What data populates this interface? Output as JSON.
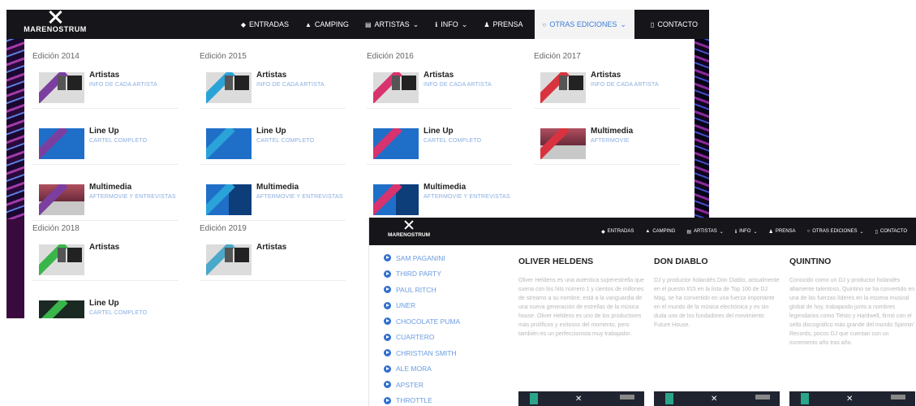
{
  "brand": "MARENOSTRUM",
  "nav": [
    {
      "label": "ENTRADAS",
      "icon": "ticket-icon"
    },
    {
      "label": "CAMPING",
      "icon": "tent-icon"
    },
    {
      "label": "ARTISTAS",
      "icon": "list-icon",
      "dropdown": true
    },
    {
      "label": "INFO",
      "icon": "info-icon",
      "dropdown": true
    },
    {
      "label": "PRENSA",
      "icon": "user-icon"
    },
    {
      "label": "OTRAS EDICIONES",
      "icon": "circle-icon",
      "dropdown": true,
      "active": true
    },
    {
      "label": "CONTACTO",
      "icon": "phone-icon"
    }
  ],
  "editions": [
    {
      "label": "Edición 2014",
      "color": "#7b3fa0",
      "items": [
        {
          "title": "Artistas",
          "sub": "INFO DE CADA ARTISTA"
        },
        {
          "title": "Line Up",
          "sub": "CARTEL COMPLETO"
        },
        {
          "title": "Multimedia",
          "sub": "AFTERMOVIE Y ENTREVISTAS"
        }
      ]
    },
    {
      "label": "Edición 2015",
      "color": "#2aa3d8",
      "items": [
        {
          "title": "Artistas",
          "sub": "INFO DE CADA ARTISTA"
        },
        {
          "title": "Line Up",
          "sub": "CARTEL COMPLETO"
        },
        {
          "title": "Multimedia",
          "sub": "AFTERMOVIE Y ENTREVISTAS"
        }
      ]
    },
    {
      "label": "Edición 2016",
      "color": "#d8336e",
      "items": [
        {
          "title": "Artistas",
          "sub": "INFO DE CADA ARTISTA"
        },
        {
          "title": "Line Up",
          "sub": "CARTEL COMPLETO"
        },
        {
          "title": "Multimedia",
          "sub": "AFTERMOVIE Y ENTREVISTAS"
        }
      ]
    },
    {
      "label": "Edición 2017",
      "color": "#d8333f",
      "items": [
        {
          "title": "Artistas",
          "sub": "INFO DE CADA ARTISTA"
        },
        {
          "title": "Multimedia",
          "sub": "AFTERMOVIE"
        }
      ]
    },
    {
      "label": "Edición 2018",
      "color": "#3ab54a",
      "items": [
        {
          "title": "Artistas",
          "sub": ""
        },
        {
          "title": "Line Up",
          "sub": "CARTEL COMPLETO"
        }
      ]
    },
    {
      "label": "Edición 2019",
      "color": "#4aa8c8",
      "items": [
        {
          "title": "Artistas",
          "sub": ""
        }
      ]
    }
  ],
  "artists_list": [
    "SAM PAGANINI",
    "THIRD PARTY",
    "PAUL RITCH",
    "UNER",
    "CHOCOLATE PUMA",
    "CUARTERO",
    "CHRISTIAN SMITH",
    "ALE MORA",
    "APSTER",
    "THROTTLE"
  ],
  "bios": [
    {
      "name": "OLIVER HELDENS",
      "text": "Oliver Heldens es una auténtica superestrella que suena con los hits número 1 y cientos de millones de streams a su nombre, está a la vanguardia de una nueva generación de estrellas de la música house. Oliver Heldens es uno de los productores más prolíficos y exitosos del momento, pero también es un perfeccionista muy trabajador."
    },
    {
      "name": "DON DIABLO",
      "text": "DJ y productor holandés Don Diablo, actualmente en el puesto #15 en la lista de Top 100 de DJ Mag, se ha convertido en una fuerza importante en el mundo de la música electrónica y es sin duda uno de los fundadores del movimiento Future House."
    },
    {
      "name": "QUINTINO",
      "text": "Conocido como un DJ y productor holandés altamente talentoso, Quintino se ha convertido en una de las fuerzas líderes en la escena musical global de hoy, trabajando junto a nombres legendarios como Tiësto y Hardwell, firmó con el sello discográfico más grande del mundo Spinnin' Records, pocos DJ que cuentan con un incremento año tras año."
    }
  ]
}
